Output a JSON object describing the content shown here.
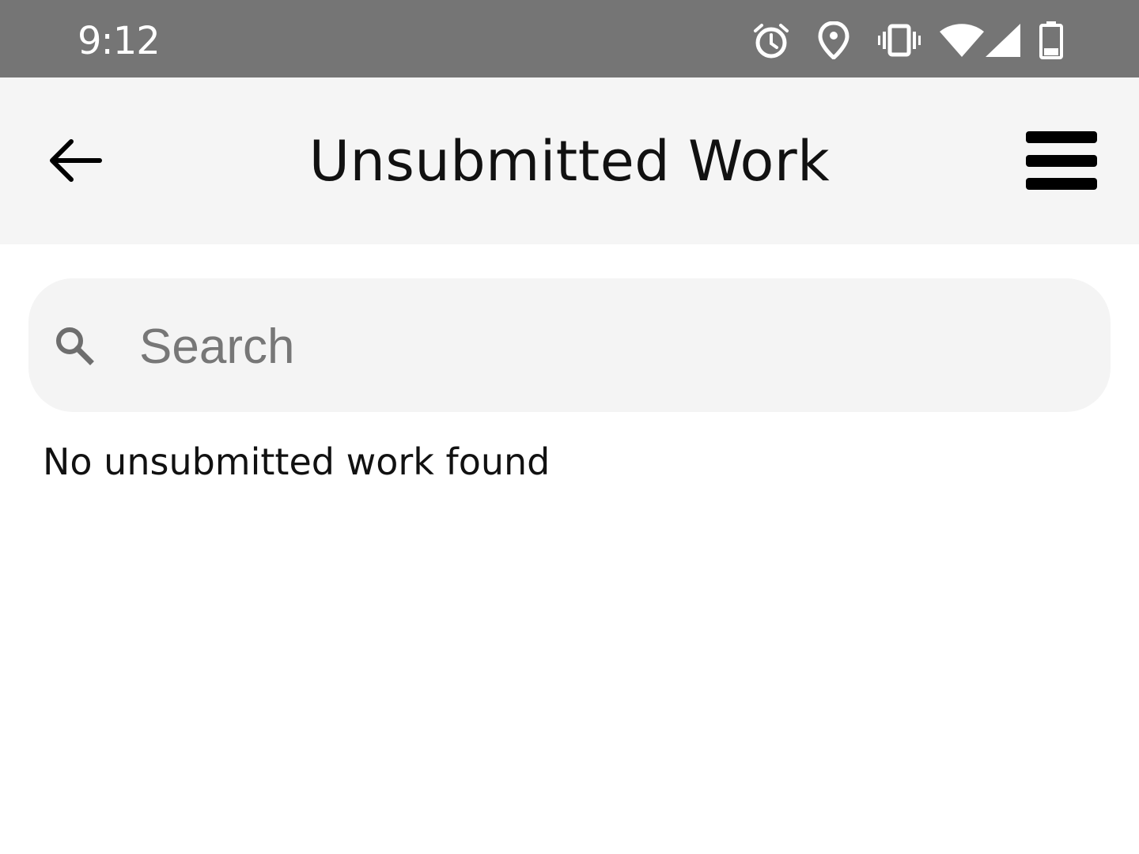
{
  "status_bar": {
    "time": "9:12",
    "icons": [
      "alarm-icon",
      "location-icon",
      "vibrate-icon",
      "wifi-icon",
      "cellular-signal-icon",
      "battery-icon"
    ]
  },
  "app_bar": {
    "title": "Unsubmitted Work",
    "back_icon": "arrow-left-icon",
    "menu_icon": "hamburger-menu-icon"
  },
  "search": {
    "placeholder": "Search",
    "value": ""
  },
  "content": {
    "empty_message": "No unsubmitted work found"
  },
  "colors": {
    "status_bar_bg": "#757575",
    "app_bar_bg": "#f5f5f5",
    "search_bg": "#f4f4f4",
    "placeholder_text": "#777777"
  }
}
